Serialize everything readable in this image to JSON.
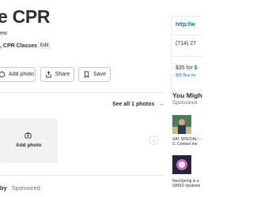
{
  "business": {
    "title": "e CPR",
    "review_text": "ew",
    "categories": ", CPR Classes",
    "edit_label": "Edit"
  },
  "actions": {
    "add_photo": "Add photo",
    "share": "Share",
    "save": "Save"
  },
  "photos": {
    "see_all": "See all 1 photos",
    "add_photo_tile": "Add photo"
  },
  "sponsored_row": {
    "name": "rby",
    "label": "Sponsored"
  },
  "sidebar": {
    "website": "http://w",
    "phone": "(714) 27",
    "price": "$35 for $",
    "buy_now": "$35 Buy no",
    "you_might": "You Migh",
    "sponsored": "Sponsored",
    "ads": [
      {
        "line1": "SAT SPECIAL! -",
        "line2": "S. Contact me"
      },
      {
        "line1": "NewSpring is a",
        "line2": "SBISD students"
      }
    ]
  },
  "colors": {
    "link": "#027a97",
    "text": "#2d2e2f",
    "muted": "#6e7072"
  }
}
